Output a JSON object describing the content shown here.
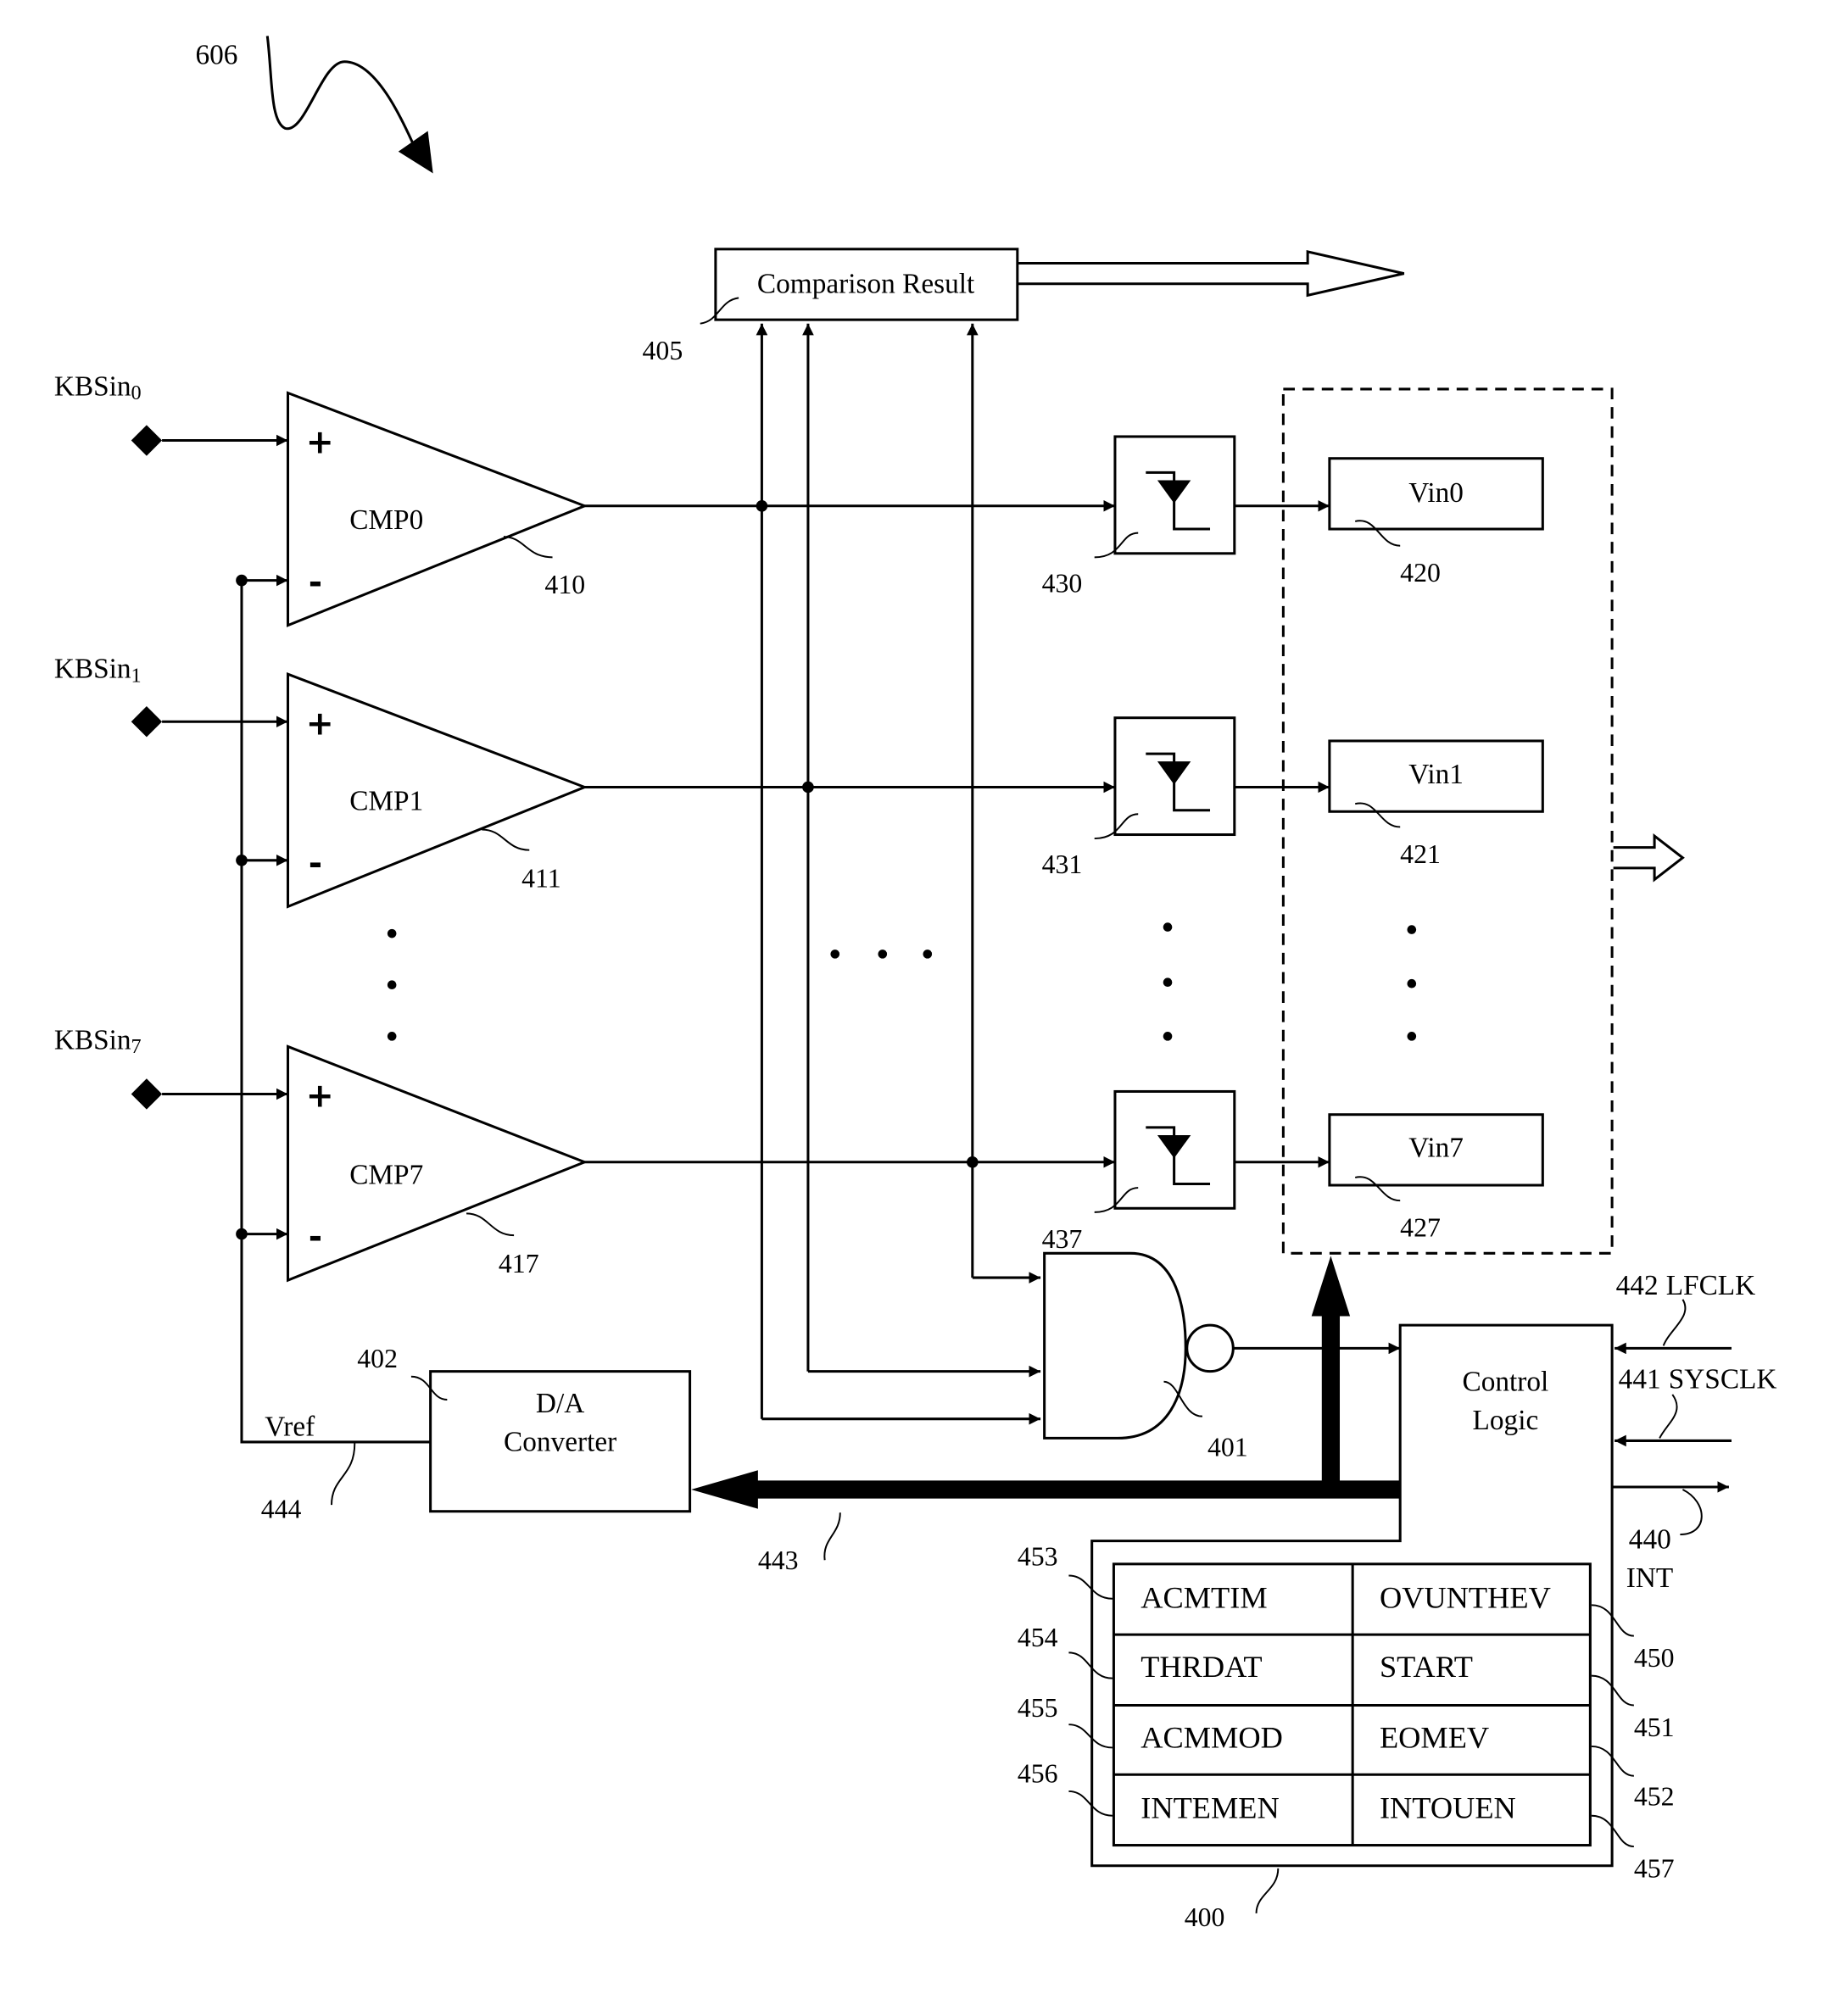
{
  "figure": {
    "ref": "606"
  },
  "comparison_result": {
    "label": "Comparison Result",
    "ref": "405"
  },
  "inputs": [
    {
      "name": "KBSin",
      "sub": "0"
    },
    {
      "name": "KBSin",
      "sub": "1"
    },
    {
      "name": "KBSin",
      "sub": "7"
    }
  ],
  "comparators": [
    {
      "label": "CMP0",
      "ref": "410",
      "plus": "+",
      "minus": "-"
    },
    {
      "label": "CMP1",
      "ref": "411",
      "plus": "+",
      "minus": "-"
    },
    {
      "label": "CMP7",
      "ref": "417",
      "plus": "+",
      "minus": "-"
    }
  ],
  "latches": [
    {
      "ref": "430"
    },
    {
      "ref": "431"
    },
    {
      "ref": "437"
    }
  ],
  "vin_registers": [
    {
      "label": "Vin0",
      "ref": "420"
    },
    {
      "label": "Vin1",
      "ref": "421"
    },
    {
      "label": "Vin7",
      "ref": "427"
    }
  ],
  "nand_gate": {
    "ref": "401"
  },
  "dac": {
    "line1": "D/A",
    "line2": "Converter",
    "ref": "402"
  },
  "vref": {
    "label": "Vref",
    "ref": "444"
  },
  "bus": {
    "ref": "443"
  },
  "control_logic": {
    "line1": "Control",
    "line2": "Logic"
  },
  "signals": {
    "lfclk": {
      "ref": "442",
      "label": "LFCLK"
    },
    "sysclk": {
      "ref": "441",
      "label": "SYSCLK"
    },
    "int": {
      "ref": "440",
      "label": "INT"
    }
  },
  "register_block": {
    "ref": "400",
    "rows": [
      {
        "left": "ACMTIM",
        "right": "OVUNTHEV",
        "left_ref": "453",
        "right_ref": "450"
      },
      {
        "left": "THRDAT",
        "right": "START",
        "left_ref": "454",
        "right_ref": "451"
      },
      {
        "left": "ACMMOD",
        "right": "EOMEV",
        "left_ref": "455",
        "right_ref": "452"
      },
      {
        "left": "INTEMEN",
        "right": "INTOUEN",
        "left_ref": "456",
        "right_ref": "457"
      }
    ]
  },
  "ellipsis": "..."
}
